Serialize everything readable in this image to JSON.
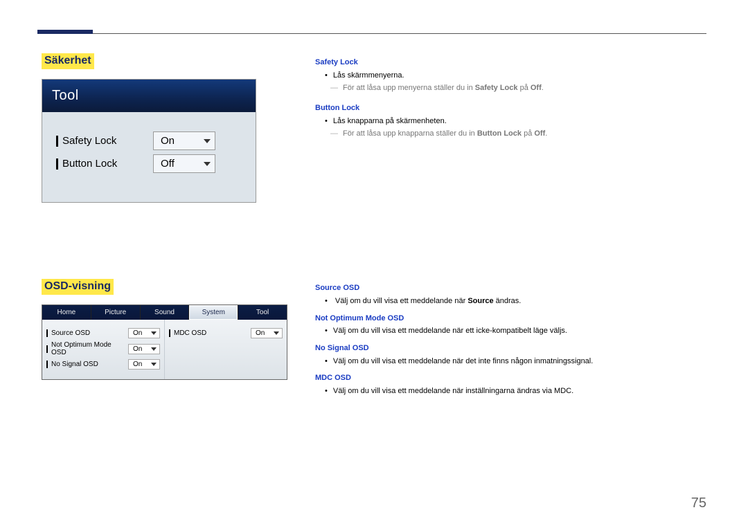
{
  "page_number": "75",
  "section1": {
    "heading": "Säkerhet",
    "tool_title": "Tool",
    "rows": [
      {
        "label": "Safety Lock",
        "value": "On"
      },
      {
        "label": "Button Lock",
        "value": "Off"
      }
    ],
    "desc": {
      "safety_lock_h": "Safety Lock",
      "safety_lock_li": "Lås skärmmenyerna.",
      "safety_lock_sub_pre": "För att låsa upp menyerna ställer du in ",
      "safety_lock_sub_bold": "Safety Lock",
      "safety_lock_sub_mid": " på ",
      "safety_lock_sub_off": "Off",
      "safety_lock_sub_end": ".",
      "button_lock_h": "Button Lock",
      "button_lock_li": "Lås knapparna på skärmenheten.",
      "button_lock_sub_pre": "För att låsa upp knapparna ställer du in ",
      "button_lock_sub_bold": "Button Lock",
      "button_lock_sub_mid": " på ",
      "button_lock_sub_off": "Off",
      "button_lock_sub_end": "."
    }
  },
  "section2": {
    "heading": "OSD-visning",
    "tabs": [
      "Home",
      "Picture",
      "Sound",
      "System",
      "Tool"
    ],
    "active_tab_index": 3,
    "left_rows": [
      {
        "label": "Source OSD",
        "value": "On"
      },
      {
        "label": "Not Optimum Mode OSD",
        "value": "On"
      },
      {
        "label": "No Signal OSD",
        "value": "On"
      }
    ],
    "right_rows": [
      {
        "label": "MDC OSD",
        "value": "On"
      }
    ],
    "desc": {
      "source_h": "Source OSD",
      "source_li_pre": "Välj om du vill visa ett meddelande när ",
      "source_li_bold": "Source",
      "source_li_post": " ändras.",
      "notopt_h": "Not Optimum Mode OSD",
      "notopt_li": "Välj om du vill visa ett meddelande när ett icke-kompatibelt läge väljs.",
      "nosig_h": "No Signal OSD",
      "nosig_li": "Välj om du vill visa ett meddelande när det inte finns någon inmatningssignal.",
      "mdc_h": "MDC OSD",
      "mdc_li": "Välj om du vill visa ett meddelande när inställningarna ändras via MDC."
    }
  }
}
